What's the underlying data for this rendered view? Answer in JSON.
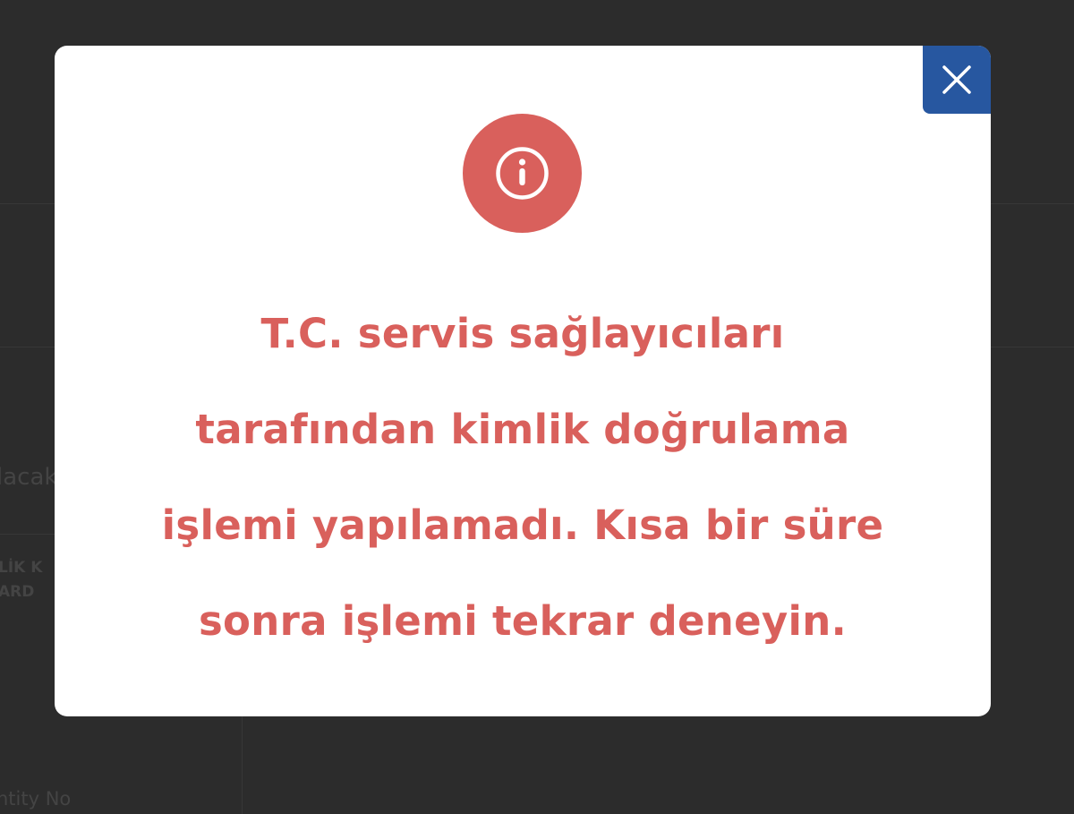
{
  "modal": {
    "close_label": "close",
    "info_icon": "info-circle-icon",
    "message_lines": [
      "T.C. servis sağlayıcıları",
      "tarafından kimlik doğrulama",
      "işlemi yapılamadı. Kısa bir süre",
      "sonra işlemi tekrar deneyin."
    ]
  },
  "background": {
    "partial_label_1": "lacak",
    "partial_label_2": "LİK K",
    "partial_label_3": "ARD",
    "partial_label_4": "ntity No"
  },
  "colors": {
    "accent_red": "#d9605c",
    "close_blue": "#2757a0",
    "backdrop": "#2f2f2f"
  }
}
